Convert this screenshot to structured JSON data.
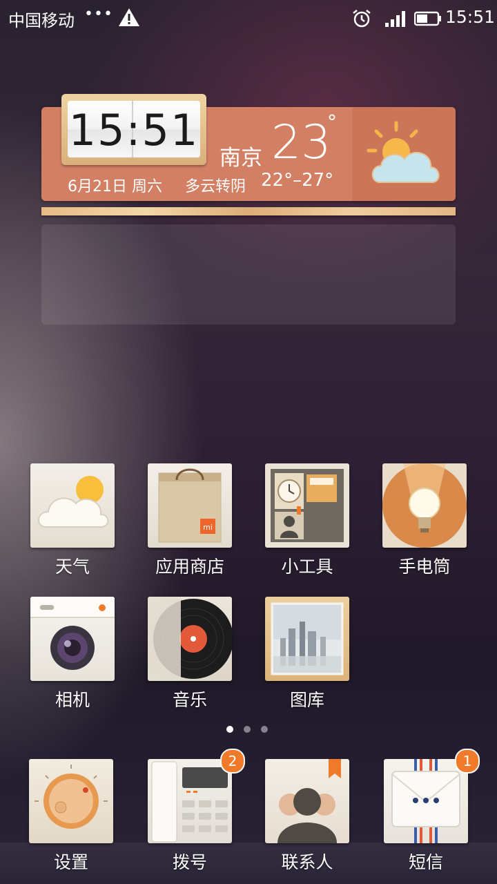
{
  "status_bar": {
    "carrier": "中国移动",
    "more": "•••",
    "time": "15:51",
    "icons": [
      "warning-icon",
      "alarm-icon",
      "signal-icon",
      "battery-icon"
    ]
  },
  "widget": {
    "clock": "15:51",
    "city": "南京",
    "temperature": "23",
    "degree_symbol": "°",
    "date": "6月21日 周六",
    "condition": "多云转阴",
    "range": "22°–27°",
    "weather_icon": "partly-cloudy-icon"
  },
  "apps": [
    {
      "label": "天气",
      "icon": "weather-icon"
    },
    {
      "label": "应用商店",
      "icon": "app-store-icon"
    },
    {
      "label": "小工具",
      "icon": "tools-icon"
    },
    {
      "label": "手电筒",
      "icon": "flashlight-icon"
    },
    {
      "label": "相机",
      "icon": "camera-icon"
    },
    {
      "label": "音乐",
      "icon": "music-icon"
    },
    {
      "label": "图库",
      "icon": "gallery-icon"
    }
  ],
  "pager": {
    "pages": 3,
    "current": 1
  },
  "dock": [
    {
      "label": "设置",
      "icon": "settings-icon",
      "badge": ""
    },
    {
      "label": "拨号",
      "icon": "phone-icon",
      "badge": "2"
    },
    {
      "label": "联系人",
      "icon": "contacts-icon",
      "badge": ""
    },
    {
      "label": "短信",
      "icon": "messages-icon",
      "badge": "1"
    }
  ],
  "colors": {
    "widget": "#d27f64",
    "badge": "#f07a2a"
  }
}
